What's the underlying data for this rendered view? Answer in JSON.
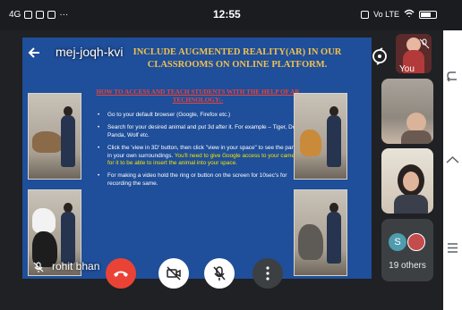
{
  "status_bar": {
    "left_text": "4G",
    "time": "12:55",
    "right_text": "Vo LTE"
  },
  "meeting": {
    "code": "mej-joqh-kvi",
    "self_name": "rohit bhan",
    "you_label": "You",
    "others_count": "19 others",
    "others_avatar_letter": "S"
  },
  "slide": {
    "title": "INCLUDE AUGMENTED REALITY(AR) IN OUR CLASSROOMS ON ONLINE PLATFORM.",
    "subtitle": "HOW TO ACCESS AND TEACH STUDENTS WITH THE HELP OF AR TECHNOLOGY:-",
    "bullets": [
      {
        "text": "Go to your default browser (Google, Firefox etc.)",
        "highlight": ""
      },
      {
        "text": "Search for your desired animal and put 3d after it. For example – Tiger, Dog, Panda, Wolf etc.",
        "highlight": ""
      },
      {
        "text": "Click the 'view in 3D' button, then click \"view in your space\" to see the panda in your own surroundings.",
        "highlight": "You'll need to give Google access to your camera for it to be able to insert the animal into your space."
      },
      {
        "text": "For making a video hold the ring or button on the screen for 10sec's for recording the same.",
        "highlight": ""
      }
    ]
  },
  "icons": {
    "back": "arrow-left-icon",
    "end_call": "phone-hangup-icon",
    "camera": "camera-off-icon",
    "mic": "mic-off-icon",
    "more": "more-vert-icon",
    "switch_camera": "camera-switch-icon",
    "nav_back": "nav-back-icon",
    "nav_home": "nav-home-icon",
    "nav_menu": "nav-menu-icon"
  },
  "colors": {
    "end_call": "#ea4335",
    "slide_bg": "#1f4e9a",
    "slide_title": "#f2c14e",
    "slide_subtitle": "#e8443a",
    "highlight": "#f5e400"
  }
}
